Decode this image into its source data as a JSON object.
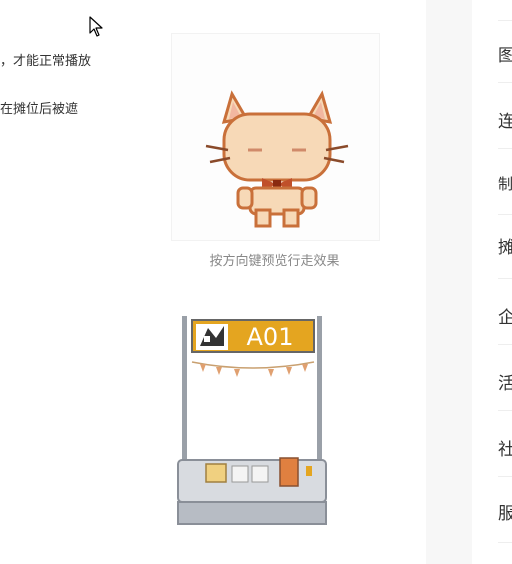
{
  "article": {
    "snippet_1": "，才能正常播放",
    "snippet_2": "在摊位后被遮"
  },
  "preview": {
    "caption": "按方向键预览行走效果",
    "booth_label": "A01"
  },
  "sidebar": {
    "items": [
      {
        "label": "图"
      },
      {
        "label": "连"
      },
      {
        "label": "制"
      },
      {
        "label": "摊"
      },
      {
        "label": "企"
      },
      {
        "label": "活"
      },
      {
        "label": "社"
      },
      {
        "label": "服"
      }
    ]
  },
  "colors": {
    "booth_sign": "#e4a520",
    "cat_body": "#f7d9b7",
    "cat_outline": "#c9703a",
    "sidebar_bg": "#f7f7f7"
  }
}
